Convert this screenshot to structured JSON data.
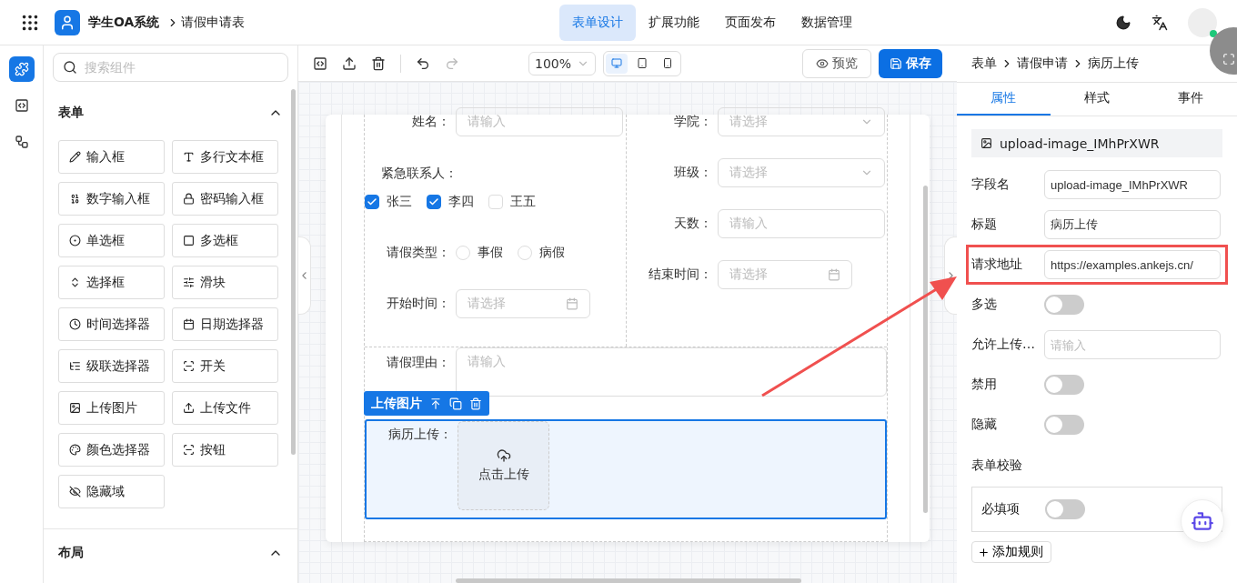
{
  "header": {
    "app_name": "学生OA系统",
    "breadcrumb": "请假申请表",
    "nav": [
      {
        "label": "表单设计",
        "selected": true
      },
      {
        "label": "扩展功能",
        "selected": false
      },
      {
        "label": "页面发布",
        "selected": false
      },
      {
        "label": "数据管理",
        "selected": false
      }
    ]
  },
  "rail": [
    {
      "kind": "components",
      "selected": true
    },
    {
      "kind": "code",
      "selected": false
    },
    {
      "kind": "tree",
      "selected": false
    }
  ],
  "components_panel": {
    "search": {
      "placeholder": "搜索组件"
    },
    "sections": [
      {
        "title": "表单",
        "expanded": true,
        "items": [
          {
            "kind": "input",
            "label": "输入框"
          },
          {
            "kind": "textarea",
            "label": "多行文本框"
          },
          {
            "kind": "number",
            "label": "数字输入框"
          },
          {
            "kind": "password",
            "label": "密码输入框"
          },
          {
            "kind": "radio",
            "label": "单选框"
          },
          {
            "kind": "checkbox",
            "label": "多选框"
          },
          {
            "kind": "select",
            "label": "选择框"
          },
          {
            "kind": "slider",
            "label": "滑块"
          },
          {
            "kind": "time",
            "label": "时间选择器"
          },
          {
            "kind": "date",
            "label": "日期选择器"
          },
          {
            "kind": "cascader",
            "label": "级联选择器"
          },
          {
            "kind": "switch",
            "label": "开关"
          },
          {
            "kind": "image",
            "label": "上传图片"
          },
          {
            "kind": "file",
            "label": "上传文件"
          },
          {
            "kind": "color",
            "label": "颜色选择器"
          },
          {
            "kind": "button",
            "label": "按钮"
          },
          {
            "kind": "hidden",
            "label": "隐藏域"
          }
        ]
      },
      {
        "title": "布局",
        "expanded": true
      }
    ]
  },
  "toolbar": {
    "zoom": "100%",
    "devices": [
      {
        "kind": "desktop",
        "selected": true
      },
      {
        "kind": "tablet",
        "selected": false
      },
      {
        "kind": "phone",
        "selected": false
      }
    ],
    "preview": "预览",
    "save": "保存"
  },
  "form": {
    "left": [
      {
        "kind": "input",
        "label": "姓名：",
        "placeholder": "请输入"
      },
      {
        "kind": "checkbox",
        "label": "紧急联系人：",
        "options": [
          {
            "label": "张三",
            "checked": true
          },
          {
            "label": "李四",
            "checked": true
          },
          {
            "label": "王五",
            "checked": false
          }
        ]
      },
      {
        "kind": "radio",
        "label": "请假类型：",
        "options": [
          {
            "label": "事假",
            "selected": false
          },
          {
            "label": "病假",
            "selected": false
          }
        ]
      },
      {
        "kind": "date",
        "label": "开始时间：",
        "placeholder": "请选择"
      }
    ],
    "right": [
      {
        "kind": "select",
        "label": "学院：",
        "placeholder": "请选择"
      },
      {
        "kind": "select",
        "label": "班级：",
        "placeholder": "请选择"
      },
      {
        "kind": "input",
        "label": "天数：",
        "placeholder": "请输入"
      },
      {
        "kind": "date",
        "label": "结束时间：",
        "placeholder": "请选择"
      }
    ],
    "reason": {
      "label": "请假理由：",
      "placeholder": "请输入"
    },
    "selected_field": {
      "tag": "上传图片",
      "label": "病历上传：",
      "upload_text": "点击上传"
    }
  },
  "properties": {
    "breadcrumb": [
      "表单",
      "请假申请",
      "病历上传"
    ],
    "tabs": [
      {
        "label": "属性",
        "selected": true
      },
      {
        "label": "样式",
        "selected": false
      },
      {
        "label": "事件",
        "selected": false
      }
    ],
    "component_id": "upload-image_IMhPrXWR",
    "rows": [
      {
        "kind": "text",
        "label": "字段名",
        "value": "upload-image_IMhPrXWR"
      },
      {
        "kind": "text",
        "label": "标题",
        "value": "病历上传"
      },
      {
        "kind": "text",
        "label": "请求地址",
        "value": "https://examples.ankejs.cn/",
        "highlighted": true
      },
      {
        "kind": "switch",
        "label": "多选",
        "on": false
      },
      {
        "kind": "text",
        "label": "允许上传…",
        "placeholder": "请输入"
      },
      {
        "kind": "switch",
        "label": "禁用",
        "on": false
      },
      {
        "kind": "switch",
        "label": "隐藏",
        "on": false
      }
    ],
    "validation": {
      "title": "表单校验",
      "rules": [
        {
          "label": "必填项",
          "on": false
        }
      ],
      "add_rule": "添加规则"
    }
  }
}
